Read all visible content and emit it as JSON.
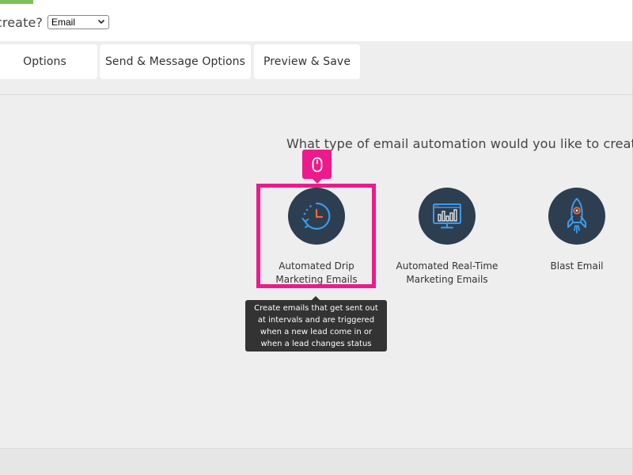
{
  "header": {
    "question_fragment": "create?",
    "type_select": {
      "selected": "Email"
    }
  },
  "tabs": [
    {
      "label": "Options"
    },
    {
      "label": "Send & Message Options"
    },
    {
      "label": "Preview & Save"
    }
  ],
  "main": {
    "heading": "What type of email automation would you like to create?",
    "options": [
      {
        "label": "Automated Drip Marketing Emails",
        "icon": "clock-refresh-icon"
      },
      {
        "label": "Automated Real-Time Marketing Emails",
        "icon": "monitor-chart-icon"
      },
      {
        "label": "Blast Email",
        "icon": "rocket-icon"
      }
    ],
    "tooltip": "Create emails that get sent out at intervals and are triggered when a new lead come in or when a lead changes status"
  },
  "colors": {
    "accent_green": "#7cc05a",
    "highlight_pink": "#ec1a8c",
    "icon_circle": "#2c3e50",
    "icon_blue": "#3d9be9",
    "icon_orange": "#f0663a"
  }
}
